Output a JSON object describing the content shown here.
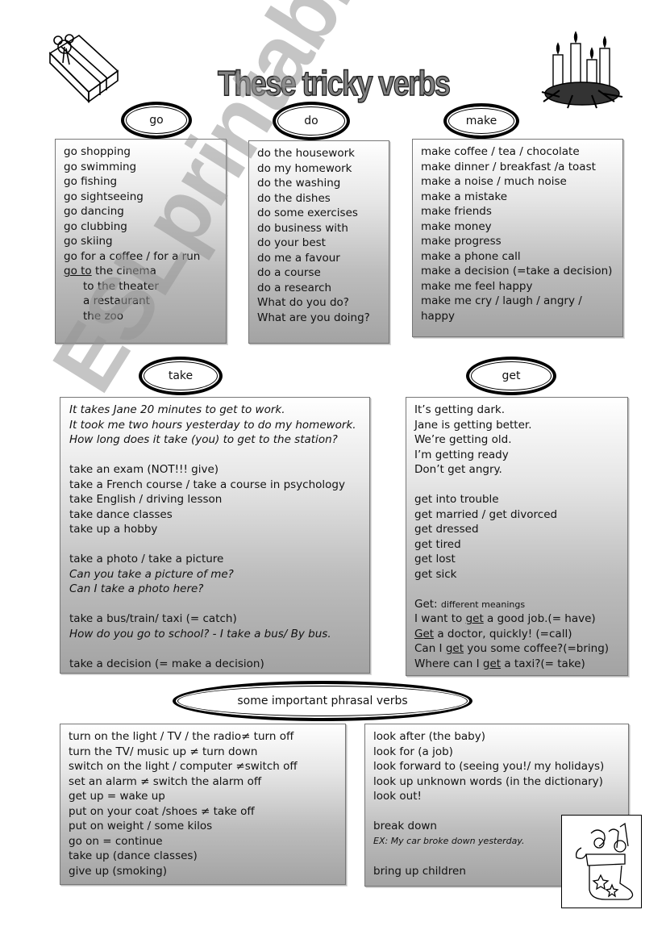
{
  "page": {
    "title": "These tricky verbs",
    "watermark": "ESLprintables.com"
  },
  "icons": {
    "top_left": "gift-box-icon",
    "top_right": "advent-wreath-icon",
    "bottom_right": "christmas-stocking-icon"
  },
  "sections": {
    "go": {
      "heading": "go",
      "lines": [
        {
          "text": "go shopping"
        },
        {
          "text": "go swimming"
        },
        {
          "text": "go fishing"
        },
        {
          "text": "go sightseeing"
        },
        {
          "text": "go dancing"
        },
        {
          "text": "go clubbing"
        },
        {
          "text": "go skiing"
        },
        {
          "text": "go for a coffee / for a run"
        },
        {
          "underlined": "go to",
          "text": " the cinema"
        },
        {
          "text": "to the theater",
          "indent": true
        },
        {
          "text": "a restaurant",
          "indent": true
        },
        {
          "text": "the zoo",
          "indent": true
        }
      ]
    },
    "do": {
      "heading": "do",
      "lines": [
        {
          "text": "do the housework"
        },
        {
          "text": "do my homework"
        },
        {
          "text": "do the washing"
        },
        {
          "text": "do the dishes"
        },
        {
          "text": "do some exercises"
        },
        {
          "text": "do business with"
        },
        {
          "text": "do your best"
        },
        {
          "text": "do me a favour"
        },
        {
          "text": "do a course"
        },
        {
          "text": "do a research"
        },
        {
          "text": "What do you do?"
        },
        {
          "text": "What are you doing?"
        }
      ]
    },
    "make": {
      "heading": "make",
      "lines": [
        {
          "text": "make coffee / tea / chocolate"
        },
        {
          "text": "make dinner / breakfast /a toast"
        },
        {
          "text": "make a noise / much noise"
        },
        {
          "text": "make a mistake"
        },
        {
          "text": "make friends"
        },
        {
          "text": "make money"
        },
        {
          "text": "make progress"
        },
        {
          "text": "make a phone call"
        },
        {
          "text": "make a decision (=take a decision)"
        },
        {
          "text": "make me feel happy"
        },
        {
          "text": "make me cry / laugh / angry /"
        },
        {
          "text": "happy"
        }
      ]
    },
    "take": {
      "heading": "take",
      "lines": [
        {
          "text": "It takes Jane 20 minutes to get to work.",
          "italic": true
        },
        {
          "text": "It took me two hours yesterday to do my homework.",
          "italic": true
        },
        {
          "text": "How long does it take (you) to get to the station?",
          "italic": true
        },
        {
          "text": ""
        },
        {
          "text": "take an exam (NOT!!! give)"
        },
        {
          "text": "take a French course / take a course in psychology"
        },
        {
          "text": "take English / driving lesson"
        },
        {
          "text": "take dance classes"
        },
        {
          "text": "take up a hobby"
        },
        {
          "text": ""
        },
        {
          "text": "take a photo / take a picture"
        },
        {
          "text": "Can you take a picture of me?",
          "italic": true
        },
        {
          "text": "Can I take a photo here?",
          "italic": true
        },
        {
          "text": ""
        },
        {
          "text": "take a bus/train/ taxi (= catch)"
        },
        {
          "text": "How do you go to school? - I take a bus/ By bus.",
          "italic": true
        },
        {
          "text": ""
        },
        {
          "text": "take a decision (= make a decision)"
        }
      ]
    },
    "get": {
      "heading": "get",
      "lines": [
        {
          "text": "It’s getting dark."
        },
        {
          "text": "Jane is getting better."
        },
        {
          "text": "We’re getting old."
        },
        {
          "text": "I’m getting ready"
        },
        {
          "text": "Don’t get angry."
        },
        {
          "text": ""
        },
        {
          "text": "get into trouble"
        },
        {
          "text": "get married / get divorced"
        },
        {
          "text": "get dressed"
        },
        {
          "text": "get tired"
        },
        {
          "text": "get lost"
        },
        {
          "text": "get sick"
        },
        {
          "text": ""
        },
        {
          "text": "Get: ",
          "small_suffix": "different meanings"
        },
        {
          "before": "I want to ",
          "underlined": "get",
          "text": " a good job.(= have)"
        },
        {
          "underlined": "Get",
          "text": " a doctor, quickly! (=call)"
        },
        {
          "before": "Can I ",
          "underlined": "get",
          "text": " you some coffee?(=bring)"
        },
        {
          "before": "Where can I ",
          "underlined": "get",
          "text": " a taxi?(= take)"
        }
      ]
    },
    "phrasal": {
      "heading": "some important phrasal verbs",
      "left_lines": [
        {
          "text": "turn on the light / TV / the radio≠ turn off"
        },
        {
          "text": "turn the TV/ music up ≠ turn down"
        },
        {
          "text": "switch on the light / computer ≠switch off"
        },
        {
          "text": "set an alarm ≠ switch the alarm off"
        },
        {
          "text": "get up = wake up"
        },
        {
          "text": "put on your coat /shoes ≠ take off"
        },
        {
          "text": "put on weight / some kilos"
        },
        {
          "text": "go on = continue"
        },
        {
          "text": "take up (dance classes)"
        },
        {
          "text": "give up (smoking)"
        }
      ],
      "right_lines": [
        {
          "text": "look after (the baby)"
        },
        {
          "text": "look for (a job)"
        },
        {
          "text": "look forward to (seeing you!/ my holidays)"
        },
        {
          "text": "look up unknown words (in the dictionary)"
        },
        {
          "text": "look out!"
        },
        {
          "text": ""
        },
        {
          "text": "break down"
        },
        {
          "text": "EX: My car broke down yesterday.",
          "italic": true,
          "small": true
        },
        {
          "text": ""
        },
        {
          "text": "bring up children"
        }
      ]
    }
  }
}
